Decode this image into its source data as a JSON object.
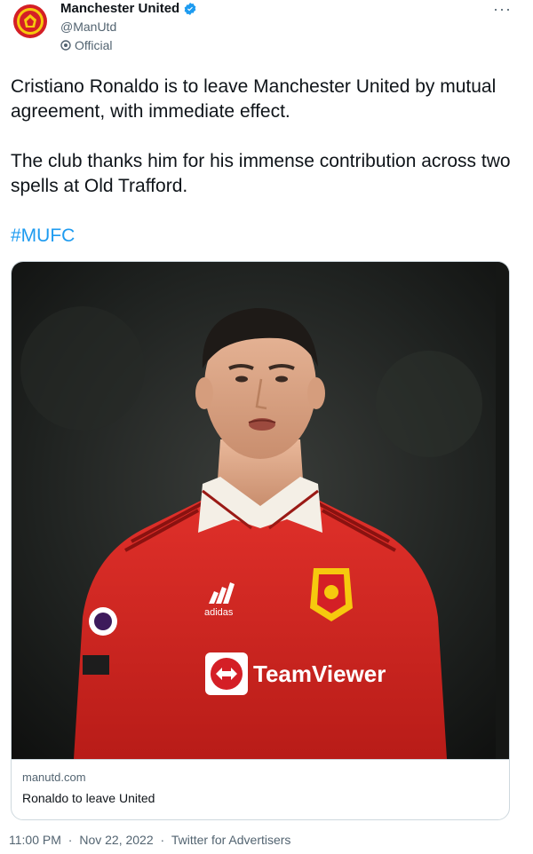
{
  "author": {
    "name": "Manchester United",
    "handle": "@ManUtd",
    "affiliation": "Official"
  },
  "tweet": {
    "line1": "Cristiano Ronaldo is to leave Manchester United by mutual agreement, with immediate effect.",
    "line2": "The club thanks him for his immense contribution across two spells at Old Trafford.",
    "hashtag": "#MUFC"
  },
  "card": {
    "domain": "manutd.com",
    "title": "Ronaldo to leave United",
    "jersey_sponsor": "TeamViewer",
    "jersey_brand": "adidas"
  },
  "meta": {
    "time": "11:00 PM",
    "separator1": "·",
    "date": "Nov 22, 2022",
    "separator2": "·",
    "source": "Twitter for Advertisers"
  },
  "colors": {
    "link": "#1d9bf0",
    "verified": "#1d9bf0",
    "jersey_red": "#d7261f",
    "text_secondary": "#536471"
  },
  "icons": [
    "club-crest-icon",
    "verified-badge-icon",
    "official-affiliation-icon",
    "more-options-icon"
  ]
}
